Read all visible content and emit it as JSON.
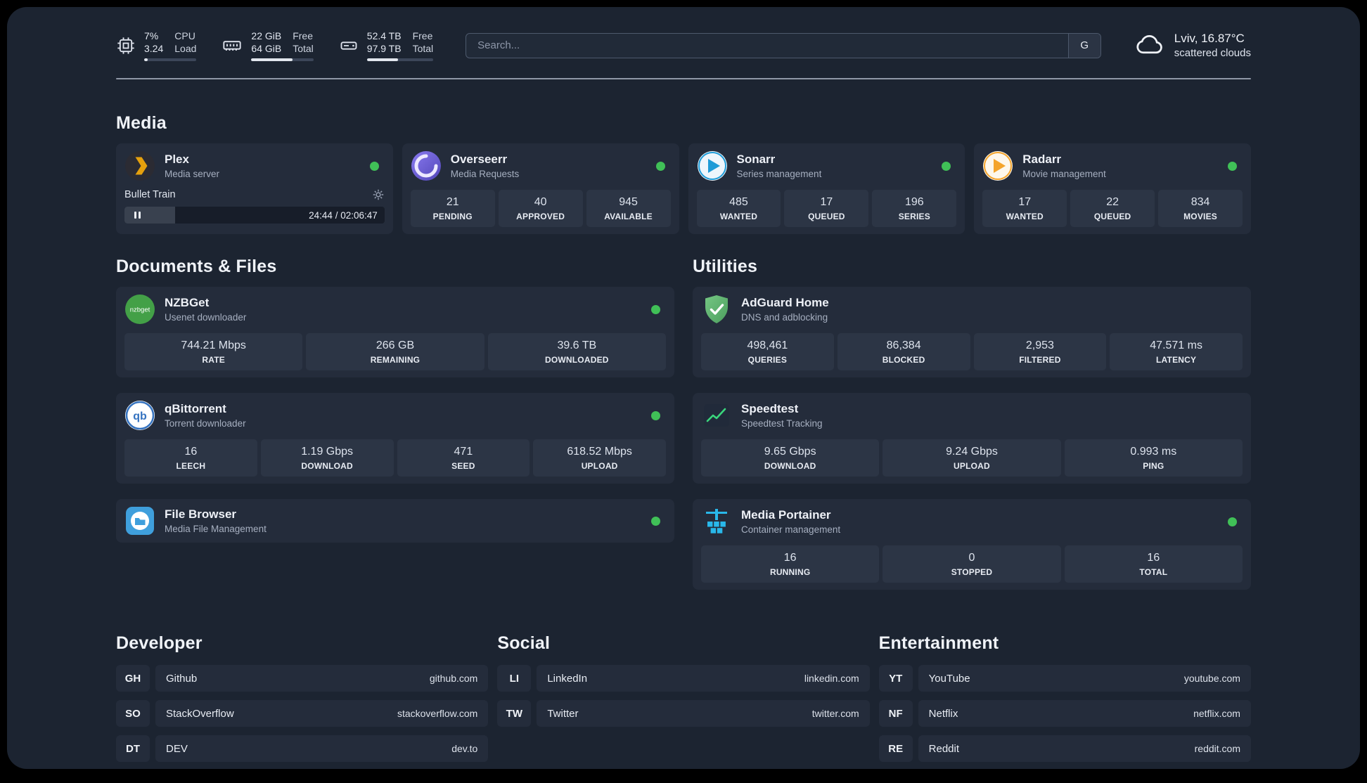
{
  "colors": {
    "background": "#1c2431",
    "card": "#242c3b",
    "stat_box": "#2c3545",
    "status_online": "#40c057",
    "plex_accent": "#e5a00d",
    "portainer_blue": "#29b8ea",
    "adguard_green": "#63b873"
  },
  "topbar": {
    "metrics": [
      {
        "icon": "cpu-icon",
        "value_top": "7%",
        "value_bottom": "3.24",
        "label_top": "CPU",
        "label_bottom": "Load",
        "bar_percent": 7
      },
      {
        "icon": "ram-icon",
        "value_top": "22 GiB",
        "value_bottom": "64 GiB",
        "label_top": "Free",
        "label_bottom": "Total",
        "bar_percent": 66
      },
      {
        "icon": "disk-icon",
        "value_top": "52.4 TB",
        "value_bottom": "97.9 TB",
        "label_top": "Free",
        "label_bottom": "Total",
        "bar_percent": 47
      }
    ],
    "search": {
      "placeholder": "Search...",
      "engine_button": "G"
    },
    "weather": {
      "location": "Lviv, 16.87°C",
      "condition": "scattered clouds"
    }
  },
  "sections": {
    "media": {
      "title": "Media",
      "apps": [
        {
          "name": "Plex",
          "subtitle": "Media server",
          "online": true,
          "player": {
            "track": "Bullet Train",
            "time": "24:44 / 02:06:47",
            "progress_percent": 19.5
          }
        },
        {
          "name": "Overseerr",
          "subtitle": "Media Requests",
          "online": true,
          "stats": [
            {
              "value": "21",
              "label": "PENDING"
            },
            {
              "value": "40",
              "label": "APPROVED"
            },
            {
              "value": "945",
              "label": "AVAILABLE"
            }
          ]
        },
        {
          "name": "Sonarr",
          "subtitle": "Series management",
          "online": true,
          "stats": [
            {
              "value": "485",
              "label": "WANTED"
            },
            {
              "value": "17",
              "label": "QUEUED"
            },
            {
              "value": "196",
              "label": "SERIES"
            }
          ]
        },
        {
          "name": "Radarr",
          "subtitle": "Movie management",
          "online": true,
          "stats": [
            {
              "value": "17",
              "label": "WANTED"
            },
            {
              "value": "22",
              "label": "QUEUED"
            },
            {
              "value": "834",
              "label": "MOVIES"
            }
          ]
        }
      ]
    },
    "documents": {
      "title": "Documents & Files",
      "apps": [
        {
          "name": "NZBGet",
          "subtitle": "Usenet downloader",
          "online": true,
          "stats": [
            {
              "value": "744.21 Mbps",
              "label": "RATE"
            },
            {
              "value": "266 GB",
              "label": "REMAINING"
            },
            {
              "value": "39.6 TB",
              "label": "DOWNLOADED"
            }
          ]
        },
        {
          "name": "qBittorrent",
          "subtitle": "Torrent downloader",
          "online": true,
          "stats": [
            {
              "value": "16",
              "label": "LEECH"
            },
            {
              "value": "1.19 Gbps",
              "label": "DOWNLOAD"
            },
            {
              "value": "471",
              "label": "SEED"
            },
            {
              "value": "618.52 Mbps",
              "label": "UPLOAD"
            }
          ]
        },
        {
          "name": "File Browser",
          "subtitle": "Media File Management",
          "online": true,
          "stats": []
        }
      ]
    },
    "utilities": {
      "title": "Utilities",
      "apps": [
        {
          "name": "AdGuard Home",
          "subtitle": "DNS and adblocking",
          "online": false,
          "stats": [
            {
              "value": "498,461",
              "label": "QUERIES"
            },
            {
              "value": "86,384",
              "label": "BLOCKED"
            },
            {
              "value": "2,953",
              "label": "FILTERED"
            },
            {
              "value": "47.571 ms",
              "label": "LATENCY"
            }
          ]
        },
        {
          "name": "Speedtest",
          "subtitle": "Speedtest Tracking",
          "online": false,
          "stats": [
            {
              "value": "9.65 Gbps",
              "label": "DOWNLOAD"
            },
            {
              "value": "9.24 Gbps",
              "label": "UPLOAD"
            },
            {
              "value": "0.993 ms",
              "label": "PING"
            }
          ]
        },
        {
          "name": "Media Portainer",
          "subtitle": "Container management",
          "online": true,
          "stats": [
            {
              "value": "16",
              "label": "RUNNING"
            },
            {
              "value": "0",
              "label": "STOPPED"
            },
            {
              "value": "16",
              "label": "TOTAL"
            }
          ]
        }
      ]
    },
    "bookmarks": [
      {
        "title": "Developer",
        "links": [
          {
            "abbr": "GH",
            "name": "Github",
            "url": "github.com"
          },
          {
            "abbr": "SO",
            "name": "StackOverflow",
            "url": "stackoverflow.com"
          },
          {
            "abbr": "DT",
            "name": "DEV",
            "url": "dev.to"
          }
        ]
      },
      {
        "title": "Social",
        "links": [
          {
            "abbr": "LI",
            "name": "LinkedIn",
            "url": "linkedin.com"
          },
          {
            "abbr": "TW",
            "name": "Twitter",
            "url": "twitter.com"
          }
        ]
      },
      {
        "title": "Entertainment",
        "links": [
          {
            "abbr": "YT",
            "name": "YouTube",
            "url": "youtube.com"
          },
          {
            "abbr": "NF",
            "name": "Netflix",
            "url": "netflix.com"
          },
          {
            "abbr": "RE",
            "name": "Reddit",
            "url": "reddit.com"
          }
        ]
      }
    ]
  }
}
